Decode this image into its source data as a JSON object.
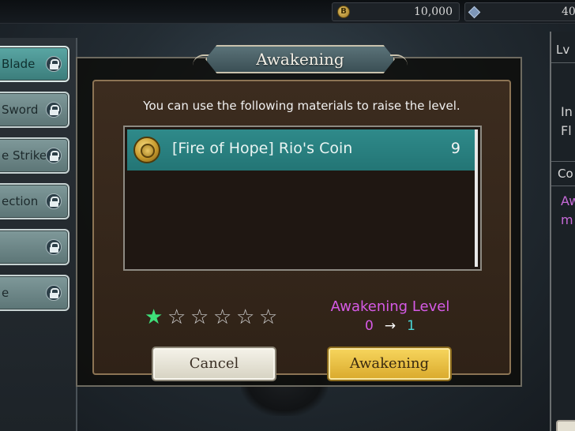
{
  "currency": {
    "gold_value": "10,000",
    "gem_value": "40"
  },
  "skills": [
    {
      "label": "Blade",
      "active": true
    },
    {
      "label": "Sword",
      "active": false
    },
    {
      "label": "e Strike",
      "active": false
    },
    {
      "label": "ection",
      "active": false
    },
    {
      "label": "",
      "active": false
    },
    {
      "label": "e",
      "active": false
    }
  ],
  "right_panel": {
    "lv_label": "Lv",
    "desc_line1": "In",
    "desc_line2": "Fl",
    "section_label": "Co",
    "pink_line1": "Aw",
    "pink_line2": "m"
  },
  "dialog": {
    "title": "Awakening",
    "instruction": "You can use the following materials to raise the level.",
    "materials": [
      {
        "name": "[Fire of Hope] Rio's Coin",
        "quantity": "9",
        "icon": "coin-icon"
      }
    ],
    "stars_total": 6,
    "stars_filled": 1,
    "level_label": "Awakening Level",
    "level_from": "0",
    "level_arrow": "→",
    "level_to": "1",
    "cancel_label": "Cancel",
    "awaken_label": "Awakening"
  },
  "colors": {
    "accent_teal": "#2f8a8a",
    "pink_text": "#d65ae6",
    "cyan_text": "#4ad6d6",
    "star_filled": "#3fe07a",
    "button_gold": "#f7d65e"
  }
}
